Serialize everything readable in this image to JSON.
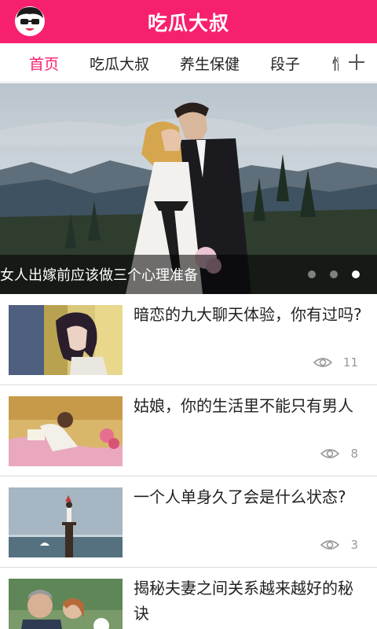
{
  "header": {
    "title": "吃瓜大叔",
    "avatar_icon": "cartoon-face-icon",
    "brand_color": "#f7206f"
  },
  "tabs": [
    {
      "label": "首页",
      "active": true
    },
    {
      "label": "吃瓜大叔",
      "active": false
    },
    {
      "label": "养生保健",
      "active": false
    },
    {
      "label": "段子",
      "active": false
    },
    {
      "label": "情",
      "active": false
    }
  ],
  "add_tab_icon": "plus-icon",
  "banner": {
    "caption": "女人出嫁前应该做三个心理准备",
    "page_count": 3,
    "active_page": 3
  },
  "articles": [
    {
      "title": "暗恋的九大聊天体验，你有过吗?",
      "views": "11"
    },
    {
      "title": "姑娘，你的生活里不能只有男人",
      "views": "8"
    },
    {
      "title": "一个人单身久了会是什么状态?",
      "views": "3"
    },
    {
      "title": "揭秘夫妻之间关系越来越好的秘诀",
      "views": ""
    }
  ]
}
